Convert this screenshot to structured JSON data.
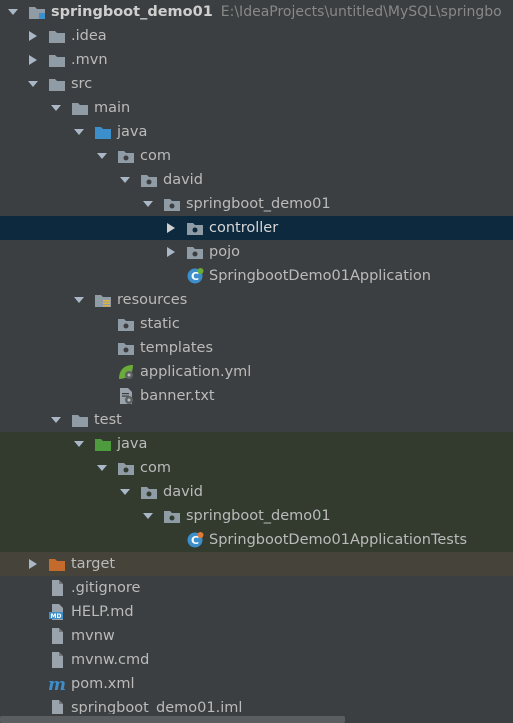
{
  "project": {
    "name": "springboot_demo01",
    "path": "E:\\IdeaProjects\\untitled\\MySQL\\springbo"
  },
  "tree": {
    "idea": ".idea",
    "mvn": ".mvn",
    "src": "src",
    "main": "main",
    "main_java": "java",
    "main_com": "com",
    "main_david": "david",
    "main_pkg": "springboot_demo01",
    "controller": "controller",
    "pojo": "pojo",
    "app_class": "SpringbootDemo01Application",
    "resources": "resources",
    "static": "static",
    "templates": "templates",
    "application_yml": "application.yml",
    "banner_txt": "banner.txt",
    "test": "test",
    "test_java": "java",
    "test_com": "com",
    "test_david": "david",
    "test_pkg": "springboot_demo01",
    "test_class": "SpringbootDemo01ApplicationTests",
    "target": "target",
    "gitignore": ".gitignore",
    "help_md": "HELP.md",
    "mvnw": "mvnw",
    "mvnw_cmd": "mvnw.cmd",
    "pom_xml": "pom.xml",
    "iml": "springboot_demo01.iml"
  },
  "colors": {
    "background": "#3c3f41",
    "selected_row": "#0d293e",
    "test_row": "#333b2f",
    "excluded_row": "#45433a",
    "folder_grey": "#8f9ba5",
    "source_blue": "#3c8fcb",
    "test_green": "#4e9a3e",
    "excluded_orange": "#c46a2c"
  },
  "icons": {
    "expand": "triangle-down",
    "collapse": "triangle-right",
    "folder": "folder-icon",
    "package": "package-icon",
    "spring_class": "spring-class-icon"
  }
}
